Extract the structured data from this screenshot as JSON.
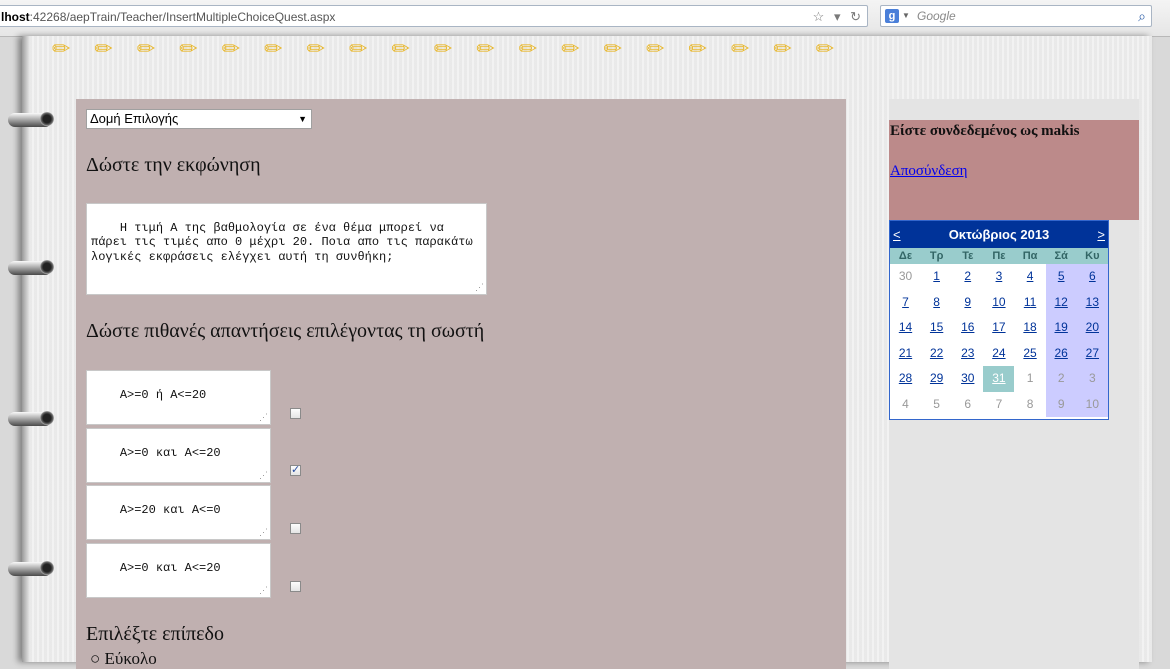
{
  "browser": {
    "url_host": "lhost",
    "url_rest": ":42268/aepTrain/Teacher/InsertMultipleChoiceQuest.aspx",
    "search_engine_letter": "g",
    "search_placeholder": "Google"
  },
  "main": {
    "question_type": "Δομή Επιλογής",
    "prompt_heading": "Δώστε την εκφώνηση",
    "question_text": "Η τιμή Α της βαθμολογία σε ένα θέμα μπορεί να πάρει τις τιμές απο 0 μέχρι 20. Ποια απο τις παρακάτω λογικές εκφράσεις ελέγχει αυτή τη συνθήκη;",
    "answers_heading": "Δώστε πιθανές απαντήσεις επιλέγοντας τη σωστή",
    "answers": [
      {
        "text": "Α>=0 ή Α<=20",
        "correct": false
      },
      {
        "text": "Α>=0 και Α<=20",
        "correct": true
      },
      {
        "text": "Α>=20 και Α<=0",
        "correct": false
      },
      {
        "text": "Α>=0 και Α<=20",
        "correct": false
      }
    ],
    "level_heading": "Επιλέξτε επίπεδο",
    "level_option": "Εύκολο"
  },
  "sidebar": {
    "logged_in_as": "Είστε συνδεδεμένος ως makis",
    "logout": "Αποσύνδεση"
  },
  "calendar": {
    "title": "Οκτώβριος 2013",
    "prev": "<",
    "next": ">",
    "days_of_week": [
      "Δε",
      "Τρ",
      "Τε",
      "Πε",
      "Πα",
      "Σά",
      "Κυ"
    ],
    "weeks": [
      [
        "30",
        "1",
        "2",
        "3",
        "4",
        "5",
        "6"
      ],
      [
        "7",
        "8",
        "9",
        "10",
        "11",
        "12",
        "13"
      ],
      [
        "14",
        "15",
        "16",
        "17",
        "18",
        "19",
        "20"
      ],
      [
        "21",
        "22",
        "23",
        "24",
        "25",
        "26",
        "27"
      ],
      [
        "28",
        "29",
        "30",
        "31",
        "1",
        "2",
        "3"
      ],
      [
        "4",
        "5",
        "6",
        "7",
        "8",
        "9",
        "10"
      ]
    ],
    "selected_day": "31",
    "colors": {
      "header": "#003399",
      "weekend": "#ccccff",
      "selected": "#99cccc",
      "other_month": "#999999"
    }
  }
}
